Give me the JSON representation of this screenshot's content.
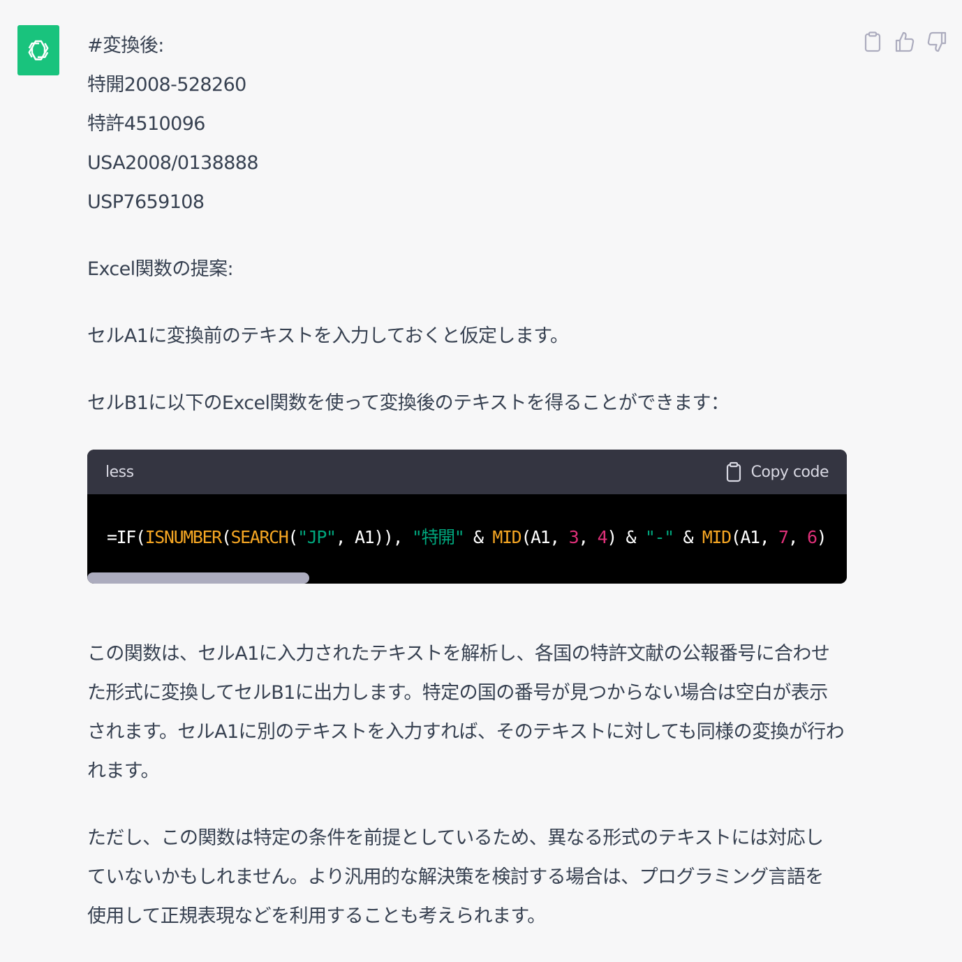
{
  "avatar": {
    "icon": "openai-logo-icon",
    "color": "#19c37d"
  },
  "actions": {
    "copy_icon": "clipboard-icon",
    "like_icon": "thumbs-up-icon",
    "dislike_icon": "thumbs-down-icon"
  },
  "message": {
    "heading": "#変換後:",
    "results": [
      "特開2008-528260",
      "特許4510096",
      "USA2008/0138888",
      "USP7659108"
    ],
    "excel_heading": "Excel関数の提案:",
    "assume": "セルA1に変換前のテキストを入力しておくと仮定します。",
    "intro": "セルB1に以下のExcel関数を使って変換後のテキストを得ることができます："
  },
  "code": {
    "language": "less",
    "copy_label": "Copy code",
    "tokens": [
      {
        "t": "=IF(",
        "k": "op"
      },
      {
        "t": "ISNUMBER",
        "k": "fn"
      },
      {
        "t": "(",
        "k": "op"
      },
      {
        "t": "SEARCH",
        "k": "fn"
      },
      {
        "t": "(",
        "k": "op"
      },
      {
        "t": "\"JP\"",
        "k": "str"
      },
      {
        "t": ", A1)), ",
        "k": "op"
      },
      {
        "t": "\"特開\"",
        "k": "str"
      },
      {
        "t": " & ",
        "k": "op"
      },
      {
        "t": "MID",
        "k": "fn"
      },
      {
        "t": "(A1, ",
        "k": "op"
      },
      {
        "t": "3",
        "k": "num"
      },
      {
        "t": ", ",
        "k": "op"
      },
      {
        "t": "4",
        "k": "num"
      },
      {
        "t": ") & ",
        "k": "op"
      },
      {
        "t": "\"-\"",
        "k": "str"
      },
      {
        "t": " & ",
        "k": "op"
      },
      {
        "t": "MID",
        "k": "fn"
      },
      {
        "t": "(A1, ",
        "k": "op"
      },
      {
        "t": "7",
        "k": "num"
      },
      {
        "t": ", ",
        "k": "op"
      },
      {
        "t": "6",
        "k": "num"
      },
      {
        "t": ")",
        "k": "op"
      }
    ],
    "colors": {
      "fn": "#f5a623",
      "str": "#00a67d",
      "num": "#df3079",
      "op": "#ffffff"
    }
  },
  "explanation": {
    "lines": [
      "この関数は、セルA1に入力されたテキストを解析し、各国の特許文献の公報番号に合わせ",
      "た形式に変換してセルB1に出力します。特定の国の番号が見つからない場合は空白が表示",
      "されます。セルA1に別のテキストを入力すれば、そのテキストに対しても同様の変換が行わ",
      "れます。"
    ]
  },
  "caveat": {
    "lines": [
      "ただし、この関数は特定の条件を前提としているため、異なる形式のテキストには対応し",
      "ていないかもしれません。より汎用的な解決策を検討する場合は、プログラミング言語を",
      "使用して正規表現などを利用することも考えられます。"
    ]
  }
}
